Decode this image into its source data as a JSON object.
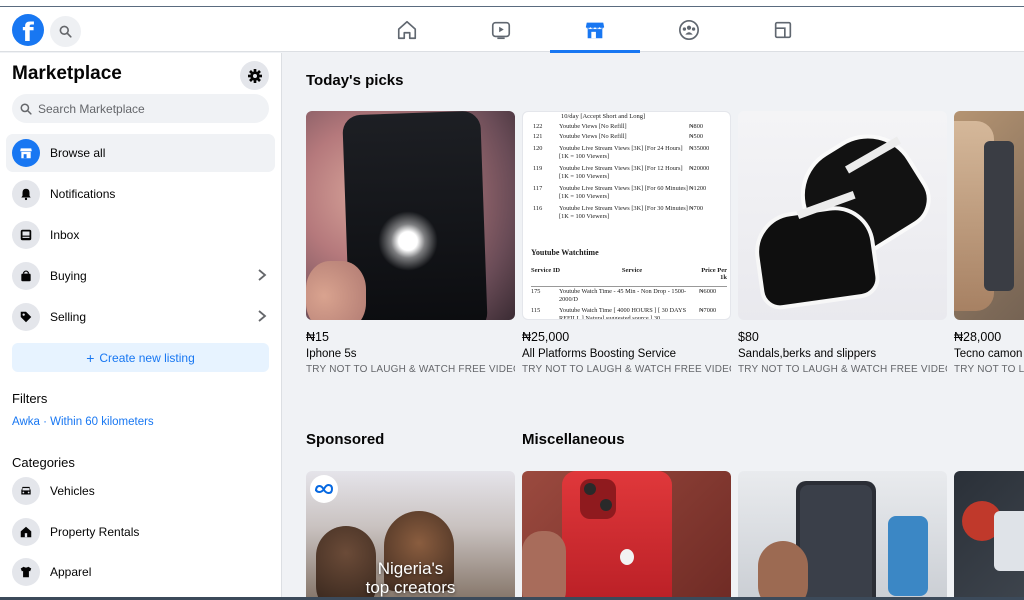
{
  "topbar": {
    "logo_letter": "f",
    "nav": [
      {
        "name": "home-icon",
        "active": false
      },
      {
        "name": "video-icon",
        "active": false
      },
      {
        "name": "marketplace-icon",
        "active": true
      },
      {
        "name": "groups-icon",
        "active": false
      },
      {
        "name": "gaming-icon",
        "active": false
      }
    ]
  },
  "sidebar": {
    "title": "Marketplace",
    "search_placeholder": "Search Marketplace",
    "items": [
      {
        "label": "Browse all",
        "icon": "storefront-icon",
        "active": true
      },
      {
        "label": "Notifications",
        "icon": "bell-icon"
      },
      {
        "label": "Inbox",
        "icon": "inbox-icon"
      },
      {
        "label": "Buying",
        "icon": "shopping-bag-icon",
        "chevron": true
      },
      {
        "label": "Selling",
        "icon": "tag-icon",
        "chevron": true
      }
    ],
    "create_label": "Create new listing",
    "filters_label": "Filters",
    "location": "Awka · Within 60 kilometers",
    "categories_label": "Categories",
    "categories": [
      {
        "label": "Vehicles",
        "icon": "car-icon"
      },
      {
        "label": "Property Rentals",
        "icon": "house-icon"
      },
      {
        "label": "Apparel",
        "icon": "shirt-icon"
      }
    ]
  },
  "main": {
    "todays_picks": "Today's picks",
    "listings": [
      {
        "price": "₦15",
        "title": "Iphone 5s",
        "seller": "TRY NOT TO LAUGH & WATCH FREE VIDEOS"
      },
      {
        "price": "₦25,000",
        "title": "All Platforms Boosting Service",
        "seller": "TRY NOT TO LAUGH & WATCH FREE VIDEOS"
      },
      {
        "price": "$80",
        "title": "Sandals,berks and slippers",
        "seller": "TRY NOT TO LAUGH & WATCH FREE VIDEOS"
      },
      {
        "price": "₦28,000",
        "title": "Tecno camon",
        "seller": "TRY NOT TO LAUGH & WATCH FREE VIDEOS"
      }
    ],
    "sponsored": "Sponsored",
    "misc": "Miscellaneous",
    "ad_text_1": "Nigeria's",
    "ad_text_2": "top creators",
    "doc": {
      "rows": [
        {
          "id": "122",
          "text": "Youtube Views [No Refill]",
          "price": "₦800"
        },
        {
          "id": "121",
          "text": "Youtube Views [No Refill]",
          "price": "₦500"
        },
        {
          "id": "120",
          "text": "Youtube Live Stream Views [3K] [For 24 Hours] [1K = 100 Viewers]",
          "price": "₦35000"
        },
        {
          "id": "119",
          "text": "Youtube Live Stream Views [3K] [For 12 Hours] [1K = 100 Viewers]",
          "price": "₦20000"
        },
        {
          "id": "117",
          "text": "Youtube Live Stream Views [3K] [For 60 Minutes] [1K = 100 Viewers]",
          "price": "₦1200"
        },
        {
          "id": "116",
          "text": "Youtube Live Stream Views [3K] [For 30 Minutes] [1K = 100 Viewers]",
          "price": "₦700"
        }
      ],
      "top_line": "10/day [Accept Short and Long]",
      "section": "Youtube Watchtime",
      "hdr_id": "Service ID",
      "hdr_service": "Service",
      "hdr_price": "Price Per 1k",
      "r175": "175",
      "r175_text": "Youtube Watch Time - 45 Min - Non Drop - 1500-2000/D",
      "r175_price": "₦6000",
      "r115": "115",
      "r115_text": "Youtube Watch Time [ 4000 HOURS ] [ 30 DAYS REFILL ] Natural suggested source ] 30",
      "r115_price": "₦7000"
    }
  }
}
